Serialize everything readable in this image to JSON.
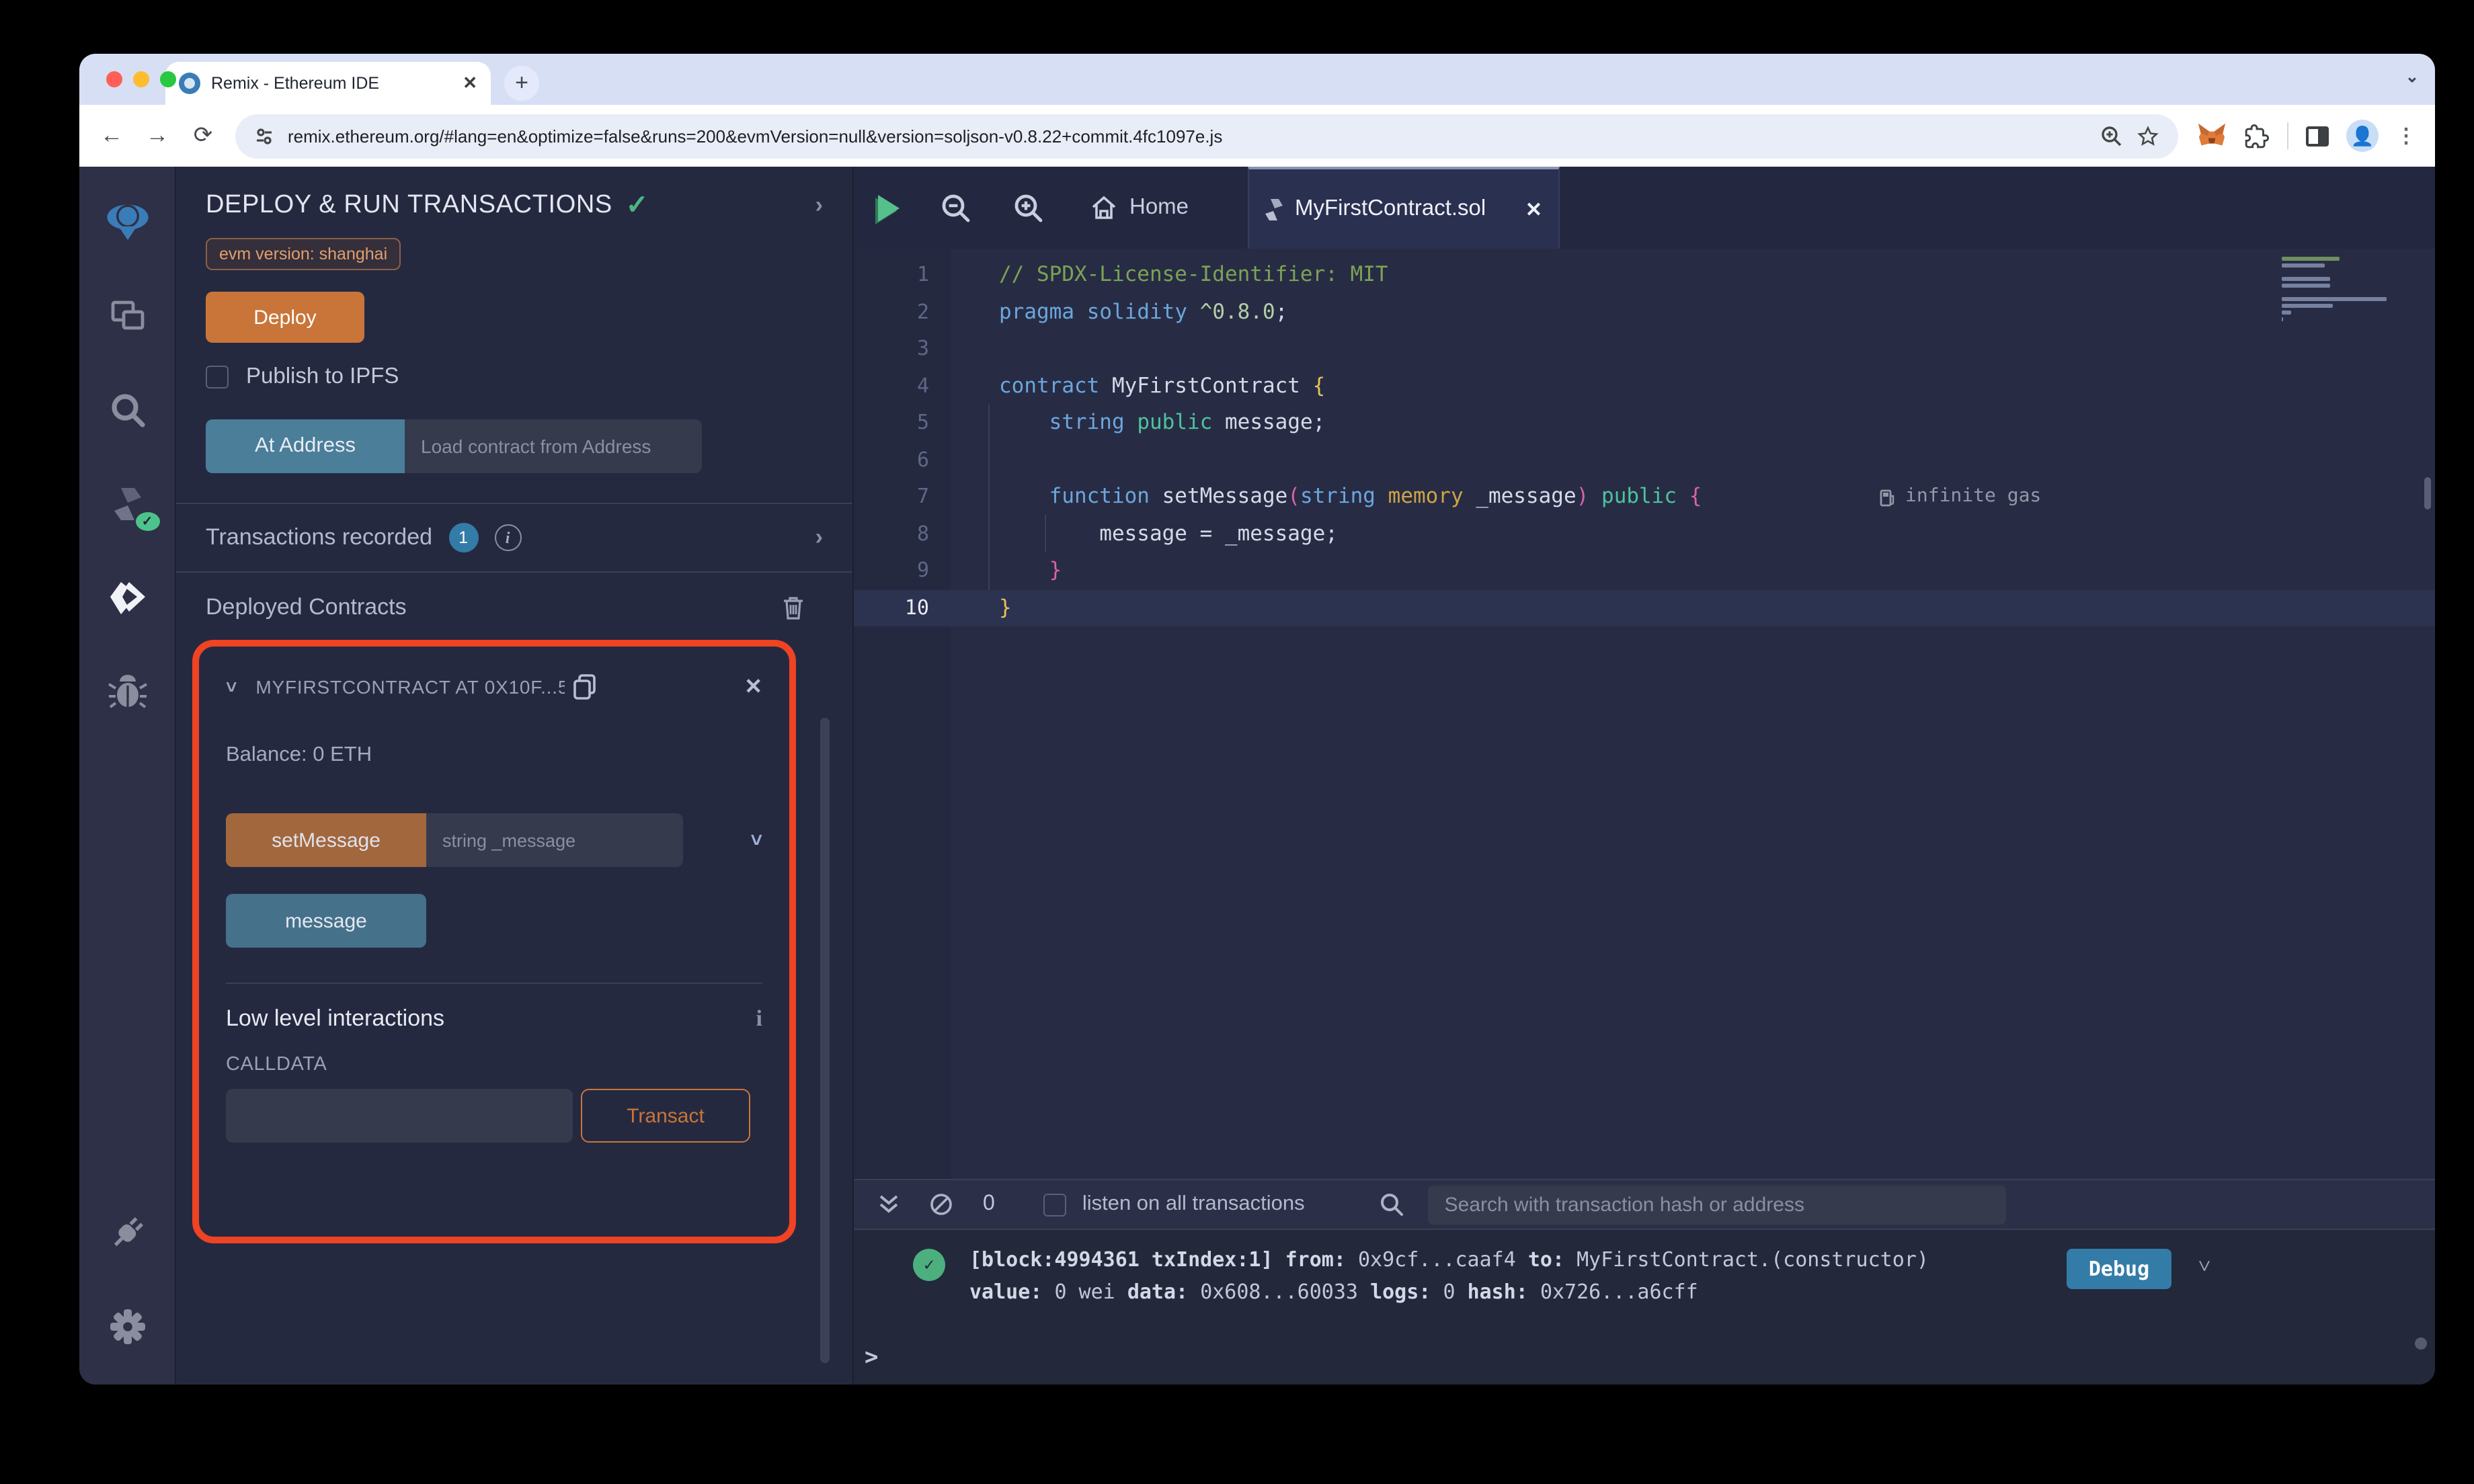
{
  "browser": {
    "tab_title": "Remix - Ethereum IDE",
    "new_tab": "+",
    "url": "remix.ethereum.org/#lang=en&optimize=false&runs=200&evmVersion=null&version=soljson-v0.8.22+commit.4fc1097e.js"
  },
  "panel": {
    "title": "DEPLOY & RUN TRANSACTIONS",
    "evm_badge": "evm version: shanghai",
    "deploy_label": "Deploy",
    "publish_label": "Publish to IPFS",
    "at_address_label": "At Address",
    "load_placeholder": "Load contract from Address",
    "tx_recorded_label": "Transactions recorded",
    "tx_count": "1",
    "deployed_label": "Deployed Contracts",
    "contract": {
      "name": "MYFIRSTCONTRACT AT 0X10F...5",
      "balance": "Balance: 0 ETH",
      "set_message_label": "setMessage",
      "set_message_placeholder": "string _message",
      "message_label": "message",
      "low_level_label": "Low level interactions",
      "calldata_label": "CALLDATA",
      "transact_label": "Transact"
    }
  },
  "editor": {
    "home_tab": "Home",
    "file_tab": "MyFirstContract.sol",
    "gas_note": "infinite gas"
  },
  "code_colors": {
    "comment": "#7ba355",
    "keyword": "#6ca6dd",
    "number": "#b5cea8",
    "plain": "#d6dae8",
    "bracket1": "#e6c25a",
    "bracket2": "#d962a8",
    "gold": "#cfa444",
    "green": "#4dc39d"
  },
  "code_lines": [
    {
      "n": 1,
      "tokens": [
        {
          "t": "// SPDX-License-Identifier: MIT",
          "c": "comment"
        }
      ]
    },
    {
      "n": 2,
      "tokens": [
        {
          "t": "pragma",
          "c": "keyword"
        },
        {
          "t": " ",
          "c": "plain"
        },
        {
          "t": "solidity",
          "c": "keyword"
        },
        {
          "t": " ",
          "c": "plain"
        },
        {
          "t": "^0.8.0",
          "c": "number"
        },
        {
          "t": ";",
          "c": "plain"
        }
      ]
    },
    {
      "n": 3,
      "tokens": []
    },
    {
      "n": 4,
      "tokens": [
        {
          "t": "contract",
          "c": "keyword"
        },
        {
          "t": " MyFirstContract ",
          "c": "plain"
        },
        {
          "t": "{",
          "c": "bracket1"
        }
      ]
    },
    {
      "n": 5,
      "tokens": [
        {
          "t": "    ",
          "c": "plain"
        },
        {
          "t": "string",
          "c": "keyword"
        },
        {
          "t": " ",
          "c": "plain"
        },
        {
          "t": "public",
          "c": "green"
        },
        {
          "t": " message;",
          "c": "plain"
        }
      ]
    },
    {
      "n": 6,
      "tokens": []
    },
    {
      "n": 7,
      "gas": true,
      "tokens": [
        {
          "t": "    ",
          "c": "plain"
        },
        {
          "t": "function",
          "c": "keyword"
        },
        {
          "t": " setMessage",
          "c": "plain"
        },
        {
          "t": "(",
          "c": "bracket2"
        },
        {
          "t": "string",
          "c": "keyword"
        },
        {
          "t": " ",
          "c": "plain"
        },
        {
          "t": "memory",
          "c": "gold"
        },
        {
          "t": " _message",
          "c": "plain"
        },
        {
          "t": ")",
          "c": "bracket2"
        },
        {
          "t": " ",
          "c": "plain"
        },
        {
          "t": "public",
          "c": "green"
        },
        {
          "t": " ",
          "c": "plain"
        },
        {
          "t": "{",
          "c": "bracket2"
        }
      ]
    },
    {
      "n": 8,
      "tokens": [
        {
          "t": "        message = _message;",
          "c": "plain"
        }
      ]
    },
    {
      "n": 9,
      "tokens": [
        {
          "t": "    ",
          "c": "plain"
        },
        {
          "t": "}",
          "c": "bracket2"
        }
      ]
    },
    {
      "n": 10,
      "current": true,
      "tokens": [
        {
          "t": "}",
          "c": "bracket1"
        }
      ]
    }
  ],
  "terminal": {
    "count": "0",
    "listen_label": "listen on all transactions",
    "search_placeholder": "Search with transaction hash or address",
    "debug_label": "Debug",
    "prompt": ">",
    "log": [
      [
        {
          "t": "[block:4994361 txIndex:1] ",
          "b": 1
        },
        {
          "t": "from: ",
          "b": 1
        },
        {
          "t": "0x9cf...caaf4 ",
          "b": 0
        },
        {
          "t": "to: ",
          "b": 1
        },
        {
          "t": "MyFirstContract.(constructor)",
          "b": 0
        }
      ],
      [
        {
          "t": "value: ",
          "b": 1
        },
        {
          "t": "0 wei ",
          "b": 0
        },
        {
          "t": "data: ",
          "b": 1
        },
        {
          "t": "0x608...60033 ",
          "b": 0
        },
        {
          "t": "logs: ",
          "b": 1
        },
        {
          "t": "0 ",
          "b": 0
        },
        {
          "t": "hash: ",
          "b": 1
        },
        {
          "t": "0x726...a6cff",
          "b": 0
        }
      ]
    ]
  }
}
